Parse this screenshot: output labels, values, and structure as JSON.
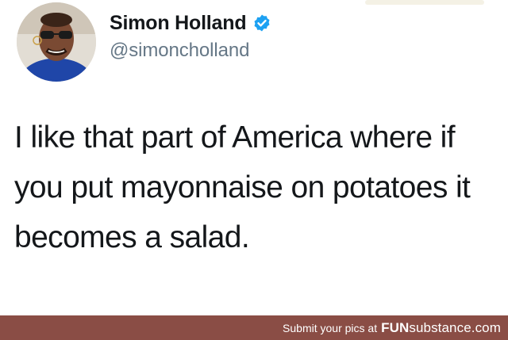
{
  "tweet": {
    "author": {
      "name": "Simon Holland",
      "handle": "@simoncholland",
      "verified": true,
      "avatar_icon": "profile-photo"
    },
    "text": "I like that part of America where if you put mayonnaise on potatoes it becomes a salad."
  },
  "watermark": {
    "caption": "Submit your pics at",
    "brand_bold": "FUN",
    "brand_rest": "substance.com"
  },
  "colors": {
    "verified_badge": "#1da1f2",
    "text": "#14171a",
    "handle": "#657786",
    "footer_bg": "#8a4d45"
  }
}
